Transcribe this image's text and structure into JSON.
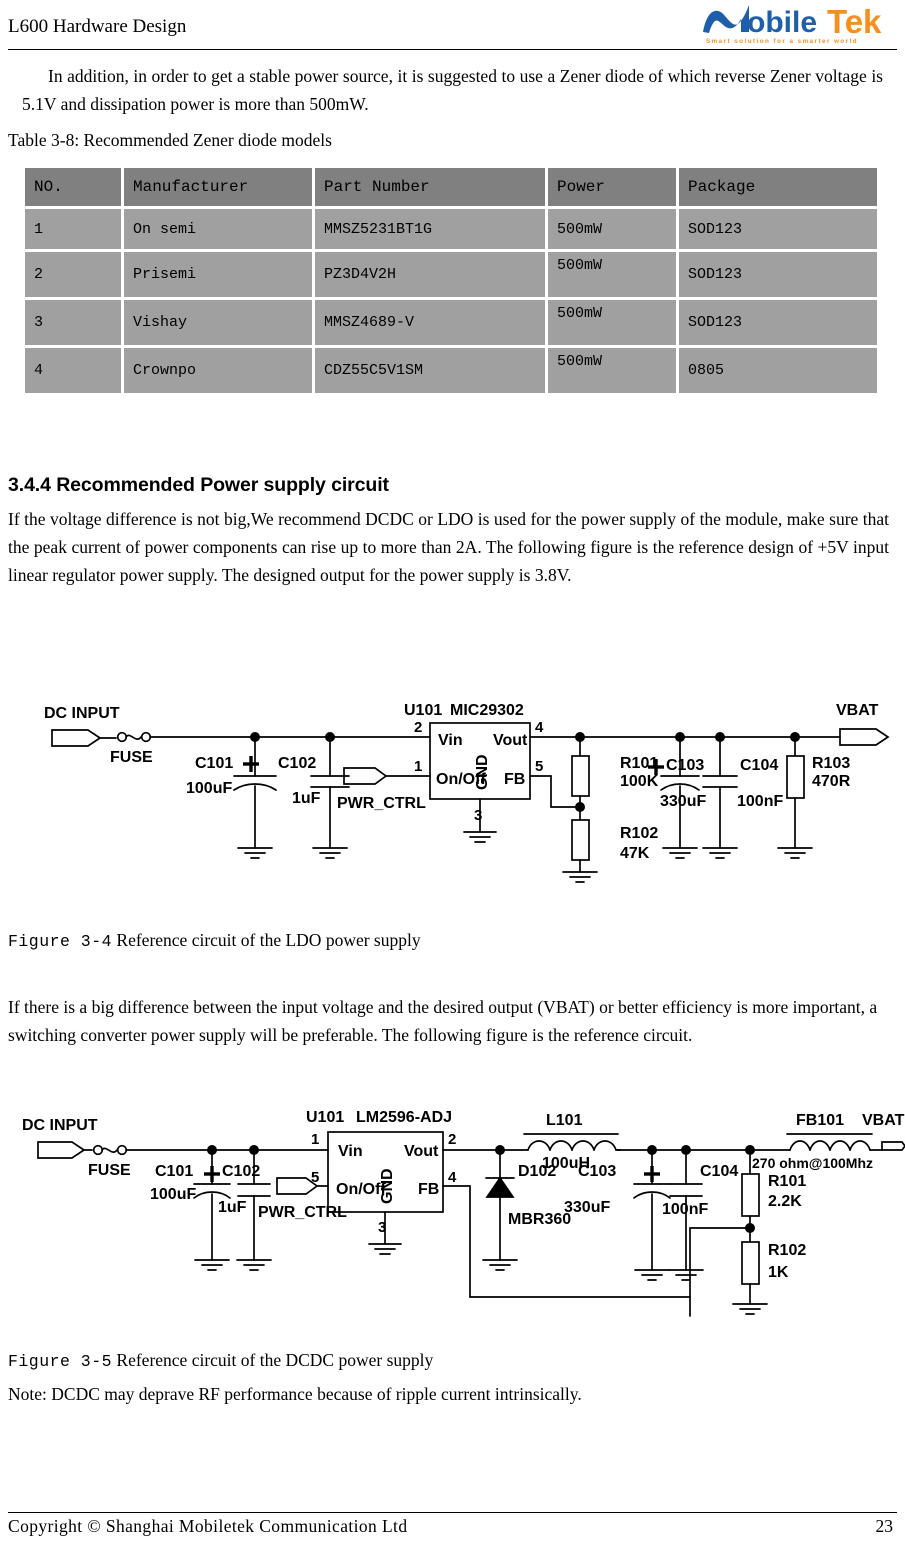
{
  "header": {
    "title": "L600 Hardware Design",
    "logo": {
      "name": "mobiletek-logo",
      "word_blue": "obile",
      "word_orange": "Tek",
      "tagline": "Smart solution for a smarter world",
      "color_blue": "#1F5FA9",
      "color_orange": "#F5901F"
    }
  },
  "intro": {
    "paragraph": "In addition, in order to get a stable power source, it is suggested to use a Zener diode of which reverse Zener voltage is 5.1V and dissipation power is more than 500mW.",
    "table_caption": "Table 3-8: Recommended Zener diode models"
  },
  "zener_table": {
    "headers": [
      "NO.",
      "Manufacturer",
      "Part Number",
      "Power",
      "Package"
    ],
    "rows": [
      [
        "1",
        "On semi",
        "MMSZ5231BT1G",
        "500mW",
        "SOD123"
      ],
      [
        "2",
        "Prisemi",
        "PZ3D4V2H",
        "500mW",
        "SOD123"
      ],
      [
        "3",
        "Vishay",
        "MMSZ4689-V",
        "500mW",
        "SOD123"
      ],
      [
        "4",
        "Crownpo",
        "CDZ55C5V1SM",
        "500mW",
        "0805"
      ]
    ],
    "header_bg": "#808080",
    "row_bg": "#a0a0a0"
  },
  "section": {
    "heading": "3.4.4 Recommended Power supply circuit",
    "body": "If the voltage difference is not big,We recommend DCDC or LDO is used for the power supply of the module, make sure that the peak current of power components can rise up to more than 2A. The following figure is the reference design of +5V input linear regulator power supply. The designed output for the power supply is 3.8V."
  },
  "figure_ldo": {
    "label": "Figure 3-4",
    "caption": "Reference circuit of the LDO power supply",
    "labels": {
      "input_port": "DC INPUT",
      "fuse": "FUSE",
      "c101": "C101",
      "c101_val": "100uF",
      "c102": "C102",
      "c102_val": "1uF",
      "pwr_ctrl": "PWR_CTRL",
      "u101": "U101",
      "u101_part": "MIC29302",
      "pin_vin": "Vin",
      "pin_onoff": "On/Off",
      "pin_gnd": "GND",
      "pin_vout": "Vout",
      "pin_fb": "FB",
      "pin_num_vin": "2",
      "pin_num_onoff": "1",
      "pin_num_gnd": "3",
      "pin_num_vout": "4",
      "pin_num_fb": "5",
      "r101": "R101",
      "r101_val": "100K",
      "r102": "R102",
      "r102_val": "47K",
      "c103": "C103",
      "c103_val": "330uF",
      "c104": "C104",
      "c104_val": "100nF",
      "r103": "R103",
      "r103_val": "470R",
      "out_port": "VBAT"
    }
  },
  "middle_text": "If there is a big difference between the input voltage and the desired output (VBAT) or better efficiency is more important, a switching converter power supply will be preferable. The following figure is the reference circuit.",
  "figure_dcdc": {
    "label": "Figure 3-5",
    "caption": "Reference circuit of the DCDC power supply",
    "note": "Note: DCDC may deprave RF performance because of ripple current intrinsically.",
    "labels": {
      "input_port": "DC INPUT",
      "fuse": "FUSE",
      "c101": "C101",
      "c101_val": "100uF",
      "c102": "C102",
      "c102_val": "1uF",
      "pwr_ctrl": "PWR_CTRL",
      "u101": "U101",
      "u101_part": "LM2596-ADJ",
      "pin_vin": "Vin",
      "pin_onoff": "On/Off",
      "pin_gnd": "GND",
      "pin_vout": "Vout",
      "pin_fb": "FB",
      "pin_num_vin": "1",
      "pin_num_onoff": "5",
      "pin_num_gnd": "3",
      "pin_num_vout": "2",
      "pin_num_fb": "4",
      "d102": "D102",
      "d102_part": "MBR360",
      "l101": "L101",
      "l101_val": "100uH",
      "c103": "C103",
      "c103_val": "330uF",
      "c104": "C104",
      "c104_val": "100nF",
      "r101": "R101",
      "r101_val": "2.2K",
      "r102": "R102",
      "r102_val": "1K",
      "fb101": "FB101",
      "fb101_val": "270 ohm@100Mhz",
      "out_port": "VBAT"
    }
  },
  "footer": {
    "copyright": "Copyright ©  Shanghai  Mobiletek  Communication  Ltd",
    "page": "23"
  }
}
